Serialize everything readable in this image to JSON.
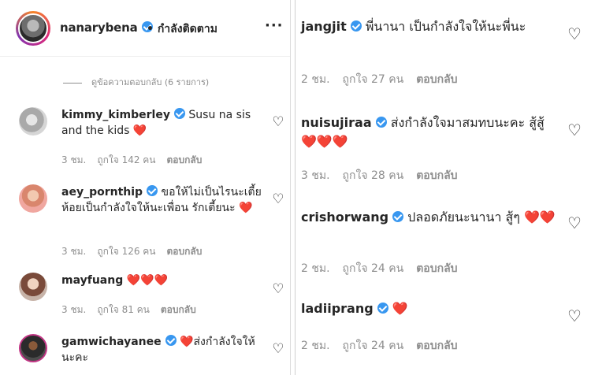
{
  "post_header": {
    "username": "nanarybena",
    "follow_label": "• กำลังติดตาม",
    "more_label": "···"
  },
  "view_replies_label": "ดูข้อความตอบกลับ (6 รายการ)",
  "left_comments": [
    {
      "username": "kimmy_kimberley",
      "text": "Susu na sis and the kids",
      "hearts": "❤️",
      "time": "3 ชม.",
      "likes": "ถูกใจ 142 คน",
      "reply": "ตอบกลับ"
    },
    {
      "username": "aey_pornthip",
      "text": "ขอให้ไม่เป็นไรนะเตี้ยห้อยเป็นกำลังใจให้นะเพื่อน รักเตี้ยนะ",
      "hearts": "❤️",
      "time": "3 ชม.",
      "likes": "ถูกใจ 126 คน",
      "reply": "ตอบกลับ"
    },
    {
      "username": "mayfuang",
      "text": "",
      "hearts": "❤️❤️❤️",
      "time": "3 ชม.",
      "likes": "ถูกใจ 81 คน",
      "reply": "ตอบกลับ"
    },
    {
      "username": "gamwichayanee",
      "text": "ส่งกำลังใจให้นะคะ",
      "hearts": "❤️",
      "time": "",
      "likes": "",
      "reply": ""
    }
  ],
  "right_comments": [
    {
      "username": "jangjit",
      "text": "พี่นานา เป็นกำลังใจให้นะพี่นะ",
      "hearts": "",
      "time": "2 ชม.",
      "likes": "ถูกใจ 27 คน",
      "reply": "ตอบกลับ"
    },
    {
      "username": "nuisujiraa",
      "text": "ส่งกำลังใจมาสมทบนะคะ สู้สู้",
      "hearts": "❤️❤️❤️",
      "time": "3 ชม.",
      "likes": "ถูกใจ 28 คน",
      "reply": "ตอบกลับ"
    },
    {
      "username": "crishorwang",
      "text": "ปลอดภัยนะนานา สู้ๆ",
      "hearts": "❤️❤️",
      "time": "2 ชม.",
      "likes": "ถูกใจ 24 คน",
      "reply": "ตอบกลับ"
    },
    {
      "username": "ladiiprang",
      "text": "",
      "hearts": "❤️",
      "time": "2 ชม.",
      "likes": "ถูกใจ 24 คน",
      "reply": "ตอบกลับ"
    }
  ],
  "icons": {
    "like": "heart-outline-icon",
    "verified": "verified-badge-icon"
  },
  "colors": {
    "verified": "#3897f0",
    "heart": "#e0245e",
    "meta": "#8e8e8e"
  }
}
